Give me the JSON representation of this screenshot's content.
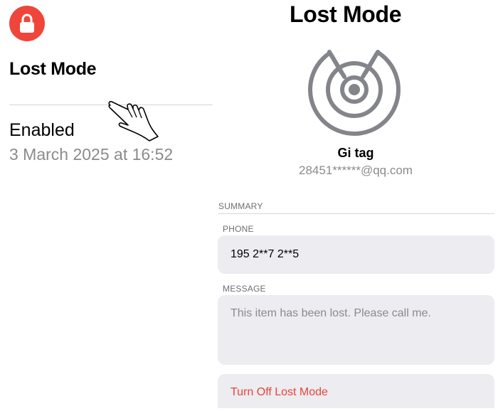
{
  "left": {
    "title": "Lost Mode",
    "status": "Enabled",
    "date": "3 March 2025 at 16:52",
    "accent_color": "#f0453a"
  },
  "right": {
    "title": "Lost Mode",
    "device_name": "Gi tag",
    "account": "28451******@qq.com",
    "section_header": "SUMMARY",
    "phone_label": "PHONE",
    "phone_value": "195 2**7 2**5",
    "message_label": "MESSAGE",
    "message_value": "This item has been lost. Please call me.",
    "turn_off_label": "Turn Off Lost Mode",
    "destructive_color": "#e8443a"
  },
  "icons": [
    "lock-icon",
    "pointing-hand-icon",
    "radar-icon"
  ]
}
